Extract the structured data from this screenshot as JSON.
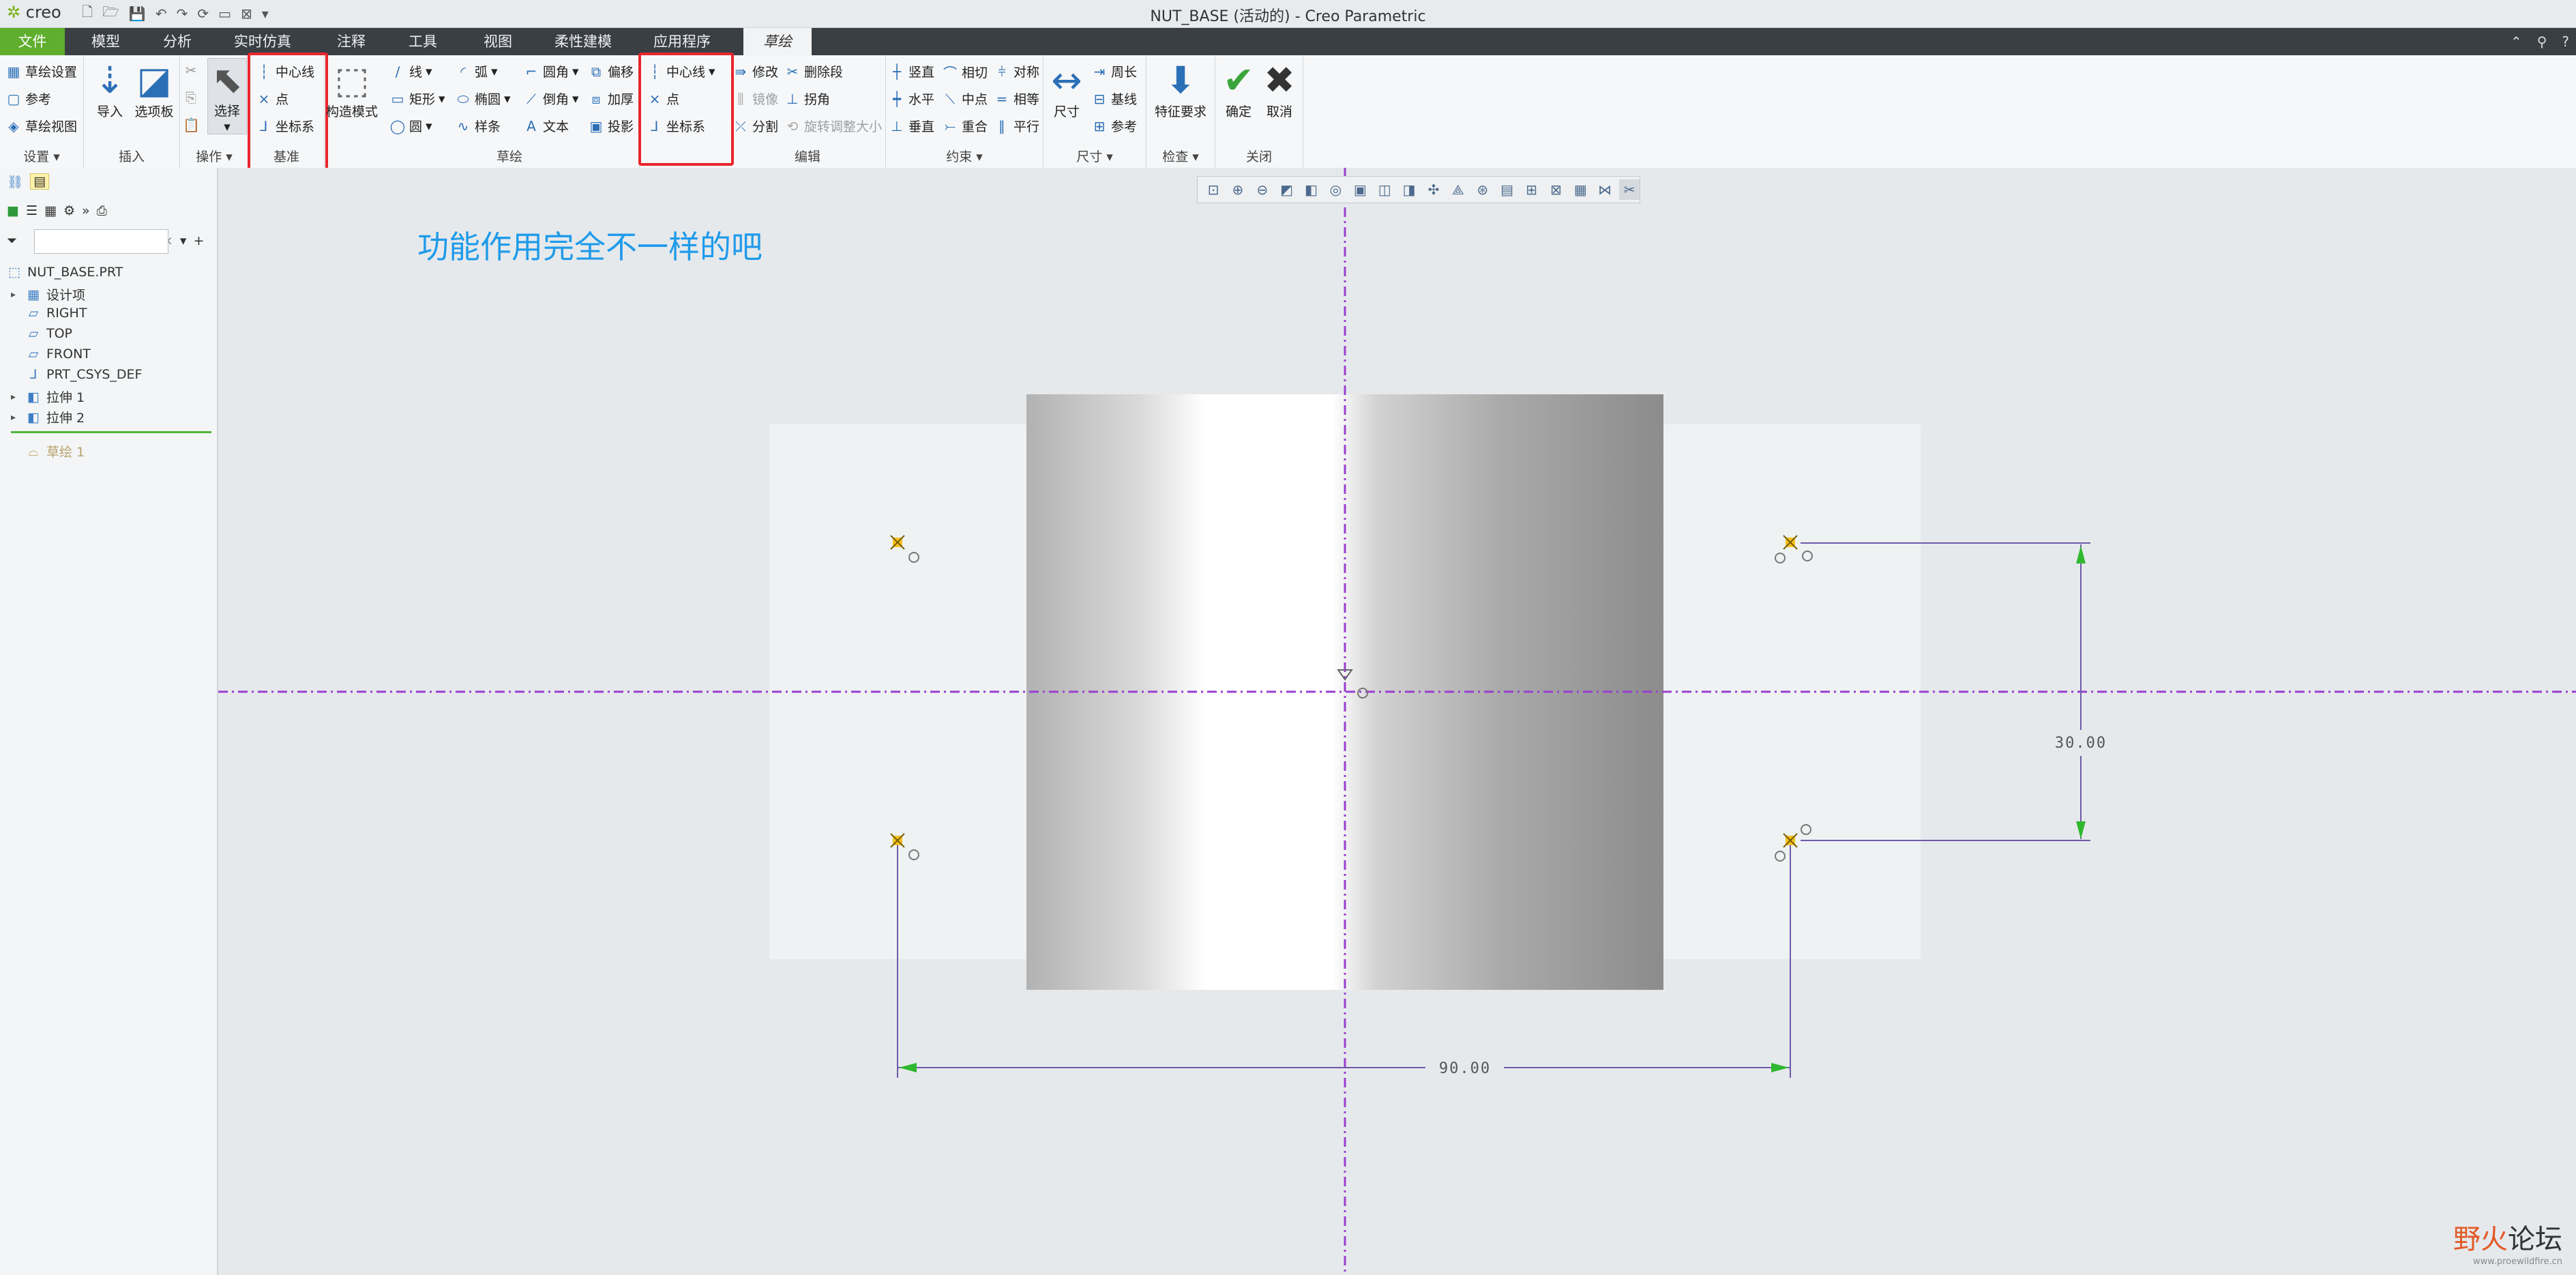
{
  "app": {
    "logo": "creo",
    "window_title": "NUT_BASE (活动的) - Creo Parametric"
  },
  "menu": {
    "file": "文件",
    "model": "模型",
    "analysis": "分析",
    "simulation": "实时仿真",
    "annotate": "注释",
    "tools": "工具",
    "view": "视图",
    "flexible": "柔性建模",
    "apps": "应用程序",
    "sketch": "草绘"
  },
  "ribbon": {
    "setup": {
      "title": "设置",
      "sketch_setup": "草绘设置",
      "references": "参考",
      "sketch_view": "草绘视图"
    },
    "insert": {
      "title": "插入",
      "import": "导入",
      "palette": "选项板"
    },
    "operations": {
      "title": "操作",
      "select": "选择"
    },
    "datum": {
      "title": "基准",
      "centerline": "中心线",
      "point": "点",
      "csys": "坐标系"
    },
    "construction_mode": "构造模式",
    "sketching": {
      "title": "草绘",
      "line": "线",
      "arc": "弧",
      "fillet": "圆角",
      "offset": "偏移",
      "rectangle": "矩形",
      "ellipse": "椭圆",
      "chamfer": "倒角",
      "thicken": "加厚",
      "circle": "圆",
      "spline": "样条",
      "text": "文本",
      "project": "投影",
      "centerline": "中心线",
      "point": "点",
      "csys": "坐标系"
    },
    "editing": {
      "title": "编辑",
      "modify": "修改",
      "delete_segment": "删除段",
      "mirror": "镜像",
      "corner": "拐角",
      "divide": "分割",
      "rotate_resize": "旋转调整大小"
    },
    "constrain": {
      "title": "约束",
      "vertical": "竖直",
      "tangent": "相切",
      "symmetric": "对称",
      "horizontal": "水平",
      "midpoint": "中点",
      "equal": "相等",
      "perpendicular": "垂直",
      "coincident": "重合",
      "parallel": "平行"
    },
    "dimension": {
      "title": "尺寸",
      "dimension": "尺寸",
      "perimeter": "周长",
      "baseline": "基线",
      "reference": "参考"
    },
    "inspect": {
      "title": "检查",
      "feature_requirements": "特征要求"
    },
    "close": {
      "title": "关闭",
      "ok": "确定",
      "cancel": "取消"
    }
  },
  "model_tree": {
    "root": "NUT_BASE.PRT",
    "items": [
      "设计项",
      "RIGHT",
      "TOP",
      "FRONT",
      "PRT_CSYS_DEF",
      "拉伸 1",
      "拉伸 2",
      "草绘 1"
    ]
  },
  "canvas": {
    "annotation": "功能作用完全不一样的吧",
    "dim_vertical": "30.00",
    "dim_horizontal": "90.00"
  },
  "watermark": {
    "brand_a": "野火",
    "brand_b": "论坛",
    "url": "www.proewildfire.cn"
  },
  "colors": {
    "menu_bg": "#3a3f44",
    "file_green": "#5fae2e",
    "highlight_red": "#e8262c",
    "annotation_blue": "#1f9bea",
    "centerline_purple": "#9a3fd0",
    "dimension_green": "#2fb82f"
  }
}
